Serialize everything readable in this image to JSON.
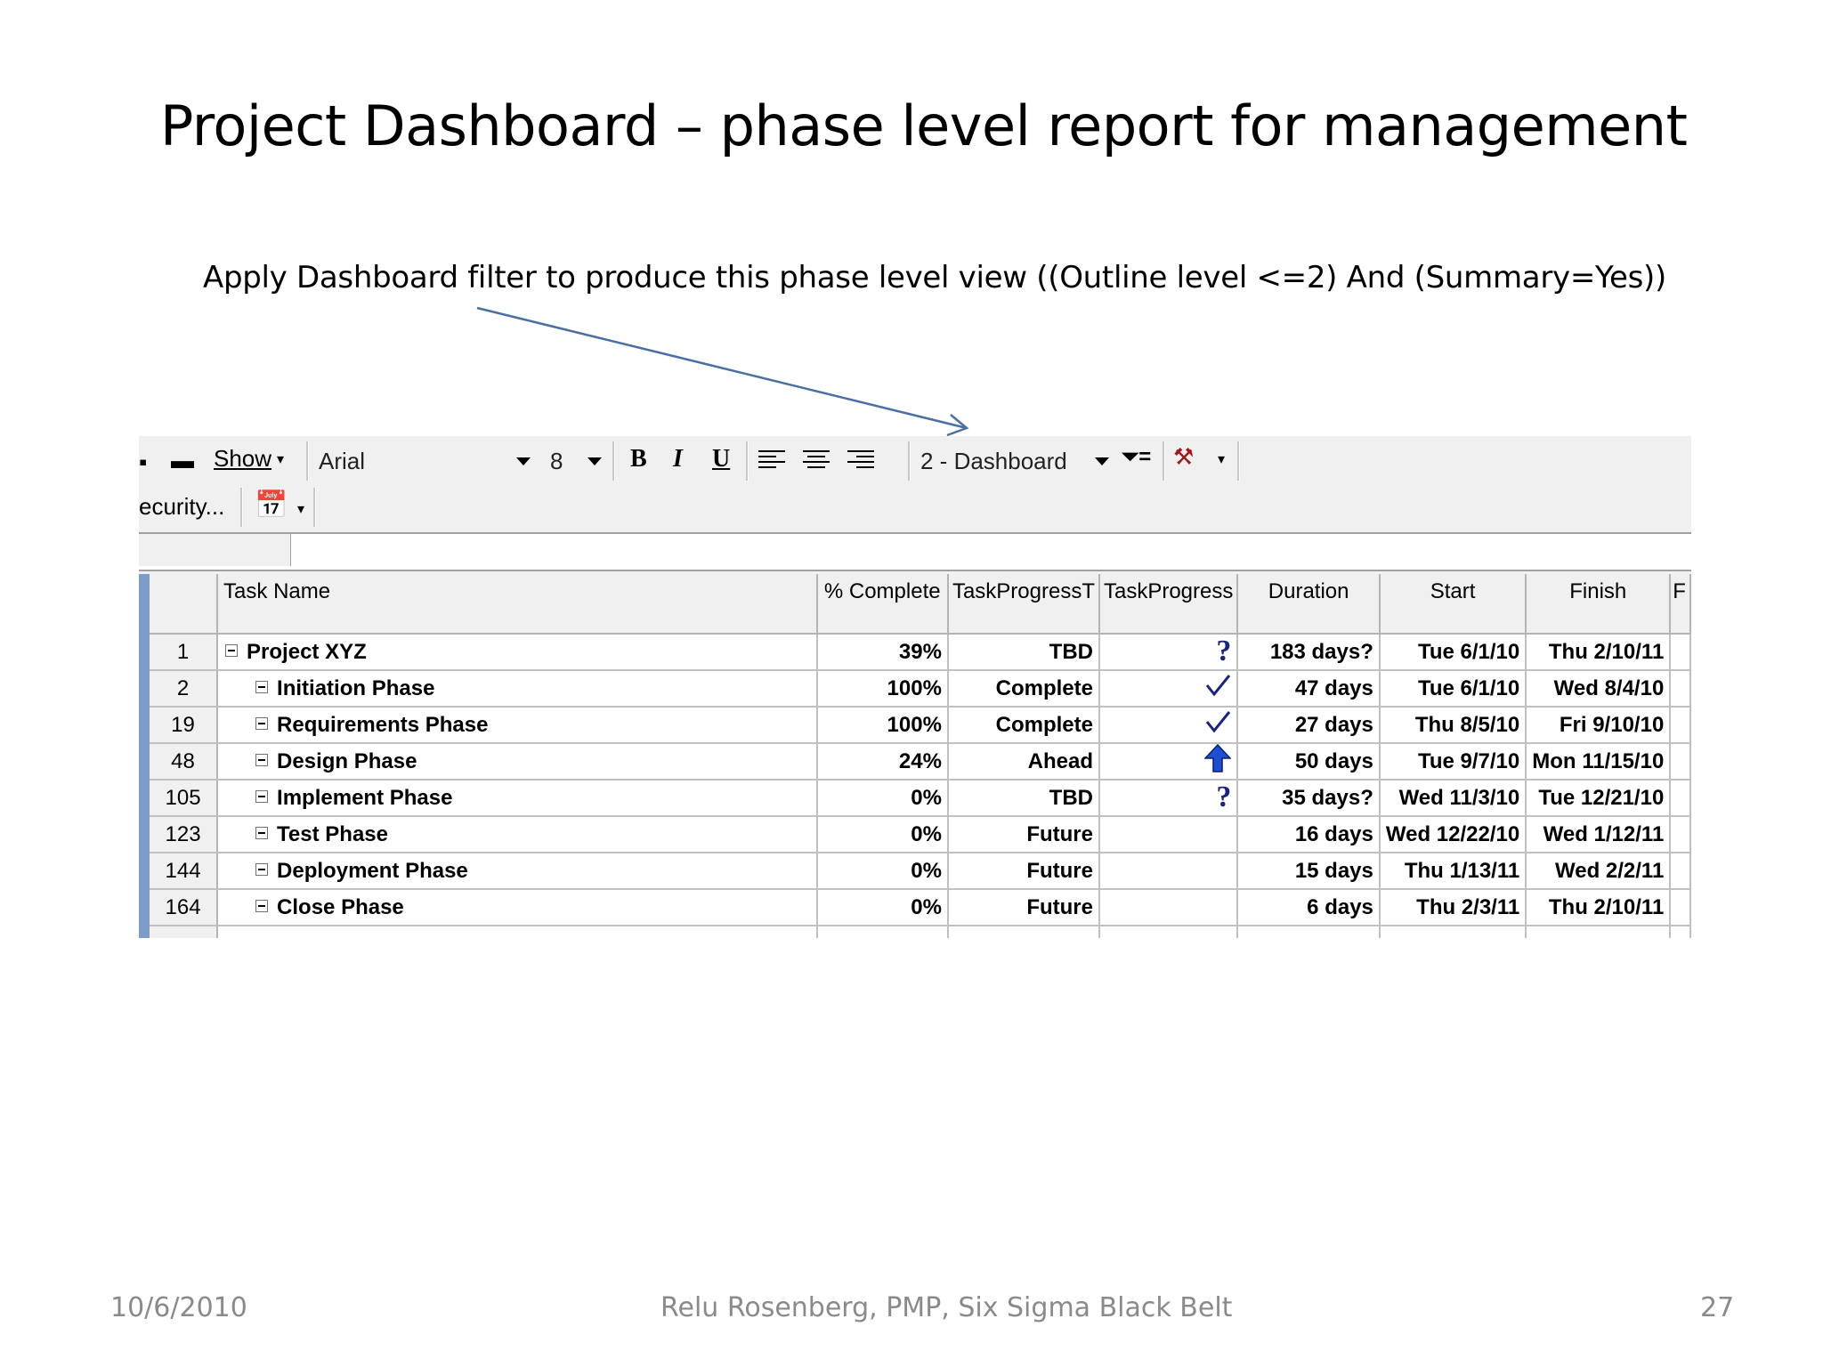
{
  "slide": {
    "title": "Project Dashboard – phase level report for management",
    "instruction": "Apply  Dashboard filter to produce this phase level view  ((Outline level <=2) And (Summary=Yes))"
  },
  "toolbar": {
    "show_label": "Show",
    "font_name": "Arial",
    "font_size": "8",
    "bold_label": "B",
    "italic_label": "I",
    "underline_label": "U",
    "filter_value": "2 - Dashboard",
    "security_label": "ecurity..."
  },
  "table": {
    "headers": {
      "task_name": "Task Name",
      "pct_complete": "% Complete",
      "task_progress_t": "TaskProgressT",
      "task_progress": "TaskProgress",
      "duration": "Duration",
      "start": "Start",
      "finish": "Finish",
      "extra": "F"
    },
    "rows": [
      {
        "id": "1",
        "name": "Project XYZ",
        "pct": "39%",
        "status": "TBD",
        "icon": "question-icon",
        "duration": "183 days?",
        "start": "Tue 6/1/10",
        "finish": "Thu 2/10/11"
      },
      {
        "id": "2",
        "name": "Initiation Phase",
        "pct": "100%",
        "status": "Complete",
        "icon": "checkmark-icon",
        "duration": "47 days",
        "start": "Tue 6/1/10",
        "finish": "Wed 8/4/10"
      },
      {
        "id": "19",
        "name": "Requirements Phase",
        "pct": "100%",
        "status": "Complete",
        "icon": "checkmark-icon",
        "duration": "27 days",
        "start": "Thu 8/5/10",
        "finish": "Fri 9/10/10"
      },
      {
        "id": "48",
        "name": "Design Phase",
        "pct": "24%",
        "status": "Ahead",
        "icon": "up-arrow-icon",
        "duration": "50 days",
        "start": "Tue 9/7/10",
        "finish": "Mon 11/15/10"
      },
      {
        "id": "105",
        "name": "Implement Phase",
        "pct": "0%",
        "status": "TBD",
        "icon": "question-icon",
        "duration": "35 days?",
        "start": "Wed 11/3/10",
        "finish": "Tue 12/21/10"
      },
      {
        "id": "123",
        "name": "Test Phase",
        "pct": "0%",
        "status": "Future",
        "icon": "",
        "duration": "16 days",
        "start": "Wed 12/22/10",
        "finish": "Wed 1/12/11"
      },
      {
        "id": "144",
        "name": "Deployment Phase",
        "pct": "0%",
        "status": "Future",
        "icon": "",
        "duration": "15 days",
        "start": "Thu 1/13/11",
        "finish": "Wed 2/2/11"
      },
      {
        "id": "164",
        "name": "Close Phase",
        "pct": "0%",
        "status": "Future",
        "icon": "",
        "duration": "6 days",
        "start": "Thu 2/3/11",
        "finish": "Thu 2/10/11"
      }
    ]
  },
  "footer": {
    "date": "10/6/2010",
    "author": "Relu Rosenberg, PMP, Six Sigma Black Belt",
    "page": "27"
  },
  "colors": {
    "arrow": "#4a6fa5",
    "question": "#1a237e",
    "checkmark": "#1a237e",
    "up_arrow": "#1f4fd1"
  }
}
